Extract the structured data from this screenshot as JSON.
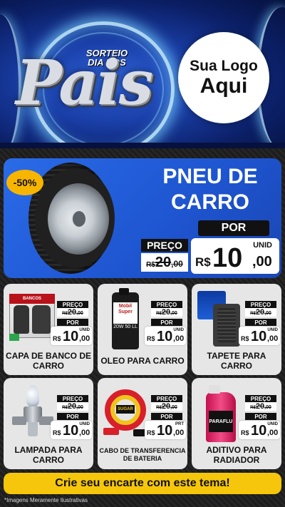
{
  "header": {
    "promo_line1": "SORTEIO",
    "promo_line2": "DIA DOS",
    "promo_word": "Pais",
    "logo_line1": "Sua Logo",
    "logo_line2": "Aqui"
  },
  "featured": {
    "discount": "-50%",
    "title_line1": "PNEU DE",
    "title_line2": "CARRO",
    "por_label": "POR",
    "preco_label": "PREÇO",
    "old_currency": "R$",
    "old_price": "20",
    "old_cents": ",00",
    "unid_label": "UNID",
    "new_currency": "R$",
    "new_price": "10",
    "new_cents": ",00"
  },
  "products": [
    {
      "name": "CAPA DE BANCO DE CARRO",
      "preco_label": "PREÇO",
      "old_currency": "R$",
      "old_price": "20",
      "old_cents": ",00",
      "por_label": "POR",
      "unit": "UNID",
      "new_currency": "R$",
      "new_price": "10",
      "new_cents": ",00",
      "art_text": "BANCOS"
    },
    {
      "name": "OLEO PARA CARRO",
      "preco_label": "PREÇO",
      "old_currency": "R$",
      "old_price": "20",
      "old_cents": ",00",
      "por_label": "POR",
      "unit": "UNID",
      "new_currency": "R$",
      "new_price": "10",
      "new_cents": ",00",
      "art_text": "Mobil Super",
      "art_text2": "20W 50 LL"
    },
    {
      "name": "TAPETE PARA CARRO",
      "preco_label": "PREÇO",
      "old_currency": "R$",
      "old_price": "20",
      "old_cents": ",00",
      "por_label": "POR",
      "unit": "UNID",
      "new_currency": "R$",
      "new_price": "10",
      "new_cents": ",00"
    },
    {
      "name": "LAMPADA PARA CARRO",
      "preco_label": "PREÇO",
      "old_currency": "R$",
      "old_price": "20",
      "old_cents": ",00",
      "por_label": "POR",
      "unit": "UNID",
      "new_currency": "R$",
      "new_price": "10",
      "new_cents": ",00"
    },
    {
      "name": "CABO DE TRANSFERENCIA DE BATERIA",
      "preco_label": "PREÇO",
      "old_currency": "R$",
      "old_price": "20",
      "old_cents": ",00",
      "por_label": "POR",
      "unit": "PRT",
      "new_currency": "R$",
      "new_price": "10",
      "new_cents": ",00",
      "art_text": "SUGAR"
    },
    {
      "name": "ADITIVO PARA RADIADOR",
      "preco_label": "PREÇO",
      "old_currency": "R$",
      "old_price": "20",
      "old_cents": ",00",
      "por_label": "POR",
      "unit": "UNID",
      "new_currency": "R$",
      "new_price": "10",
      "new_cents": ",00",
      "art_text": "PARAFLU"
    }
  ],
  "cta": "Crie seu encarte com este tema!",
  "footnote": "*Imagens Meramente Ilustrativas",
  "colors": {
    "featured_blue": "#1e54cf",
    "badge_yellow": "#f7b500",
    "cta_yellow": "#f5c60b",
    "card_bg": "#e6e6e6"
  }
}
